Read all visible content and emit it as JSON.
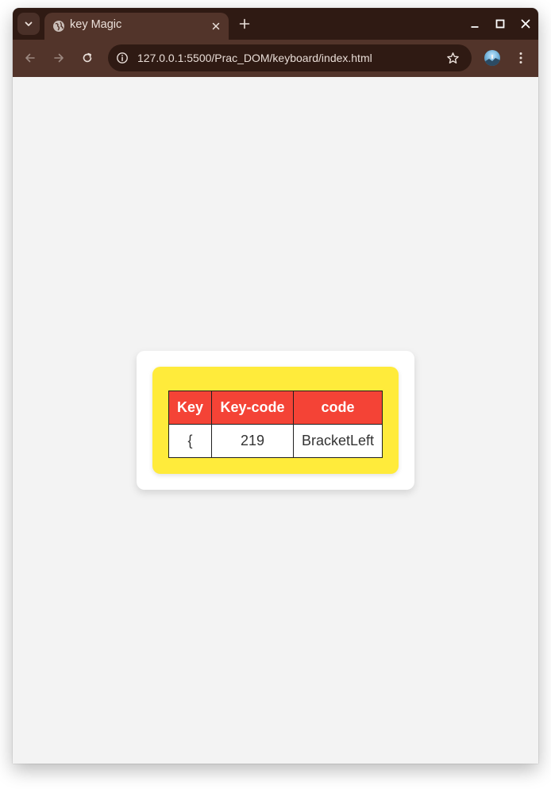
{
  "browser": {
    "tab": {
      "title": "key Magic"
    },
    "url": "127.0.0.1:5500/Prac_DOM/keyboard/index.html",
    "colors": {
      "frame": "#2f1a13",
      "toolbar": "#52342a"
    }
  },
  "page": {
    "table": {
      "headers": [
        "Key",
        "Key-code",
        "code"
      ],
      "row": {
        "key": "{",
        "key_code": "219",
        "code": "BracketLeft"
      }
    },
    "colors": {
      "background": "#f3f3f3",
      "card": "#ffffff",
      "inner": "#ffeb3b",
      "header": "#f44336"
    }
  },
  "icons": {
    "tab_search": "chevron-down-icon",
    "favicon": "globe-icon",
    "tab_close": "close-icon",
    "new_tab": "plus-icon",
    "minimize": "minimize-icon",
    "maximize": "maximize-icon",
    "close_window": "close-icon",
    "back": "arrow-left-icon",
    "forward": "arrow-right-icon",
    "reload": "reload-icon",
    "site_info": "info-icon",
    "bookmark": "star-icon",
    "profile": "avatar",
    "menu": "kebab-menu-icon"
  }
}
